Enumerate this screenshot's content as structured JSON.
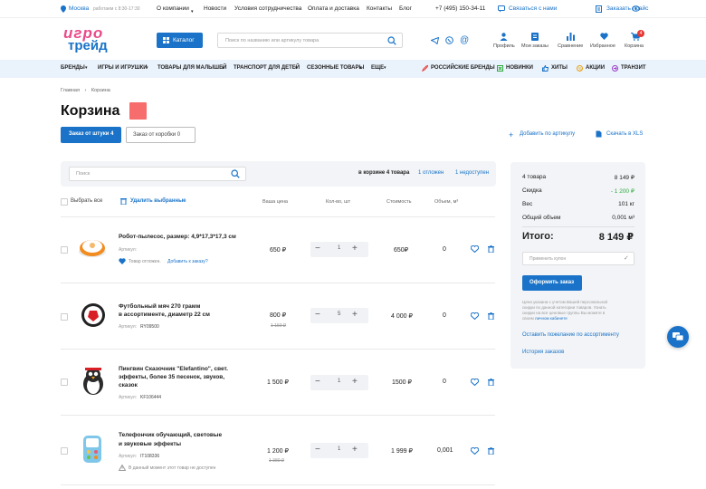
{
  "topbar": {
    "city": "Москва",
    "hours": "работаем с 8:30-17:30",
    "links": [
      "О компании",
      "Новости",
      "Условия сотрудничества",
      "Оплата и доставка",
      "Контакты",
      "Блог"
    ],
    "phone": "+7 (495) 150-34-11",
    "contact_link": "Связаться с нами",
    "price_link": "Заказать прайс"
  },
  "header": {
    "logo_top": "игро",
    "logo_bottom": "трейд",
    "catalog_label": "Каталог",
    "search_placeholder": "Поиск по названию или артикулу товара",
    "icons": [
      {
        "label": "Профиль",
        "icon": "profile-icon"
      },
      {
        "label": "Мои заказы",
        "icon": "orders-icon"
      },
      {
        "label": "Сравнение",
        "icon": "compare-icon"
      },
      {
        "label": "Избранное",
        "icon": "heart-icon"
      },
      {
        "label": "Корзина",
        "icon": "cart-icon",
        "badge": "4"
      }
    ]
  },
  "nav": {
    "items": [
      "Бренды",
      "Игры и игрушки",
      "Товары для малышей",
      "Транспорт для детей",
      "Сезонные товары",
      "Еще"
    ],
    "promo": [
      "Российские бренды",
      "Новинки",
      "Хиты",
      "Акции",
      "Транзит"
    ]
  },
  "breadcrumb": [
    "Главная",
    "Корзина"
  ],
  "page_title": "Корзина",
  "tabs": [
    "Заказ от штуки 4",
    "Заказ  от коробки 0"
  ],
  "actions": {
    "add_by_sku": "Добавить по артикулу",
    "download": "Скачать в XLS"
  },
  "filter": {
    "search_placeholder": "Поиск",
    "in_cart": "в корзине 4 товара",
    "deferred": "1 отложен",
    "unavailable": "1 недоступен"
  },
  "table": {
    "select_all": "Выбрать все",
    "delete_selected": "Удалить выбранные",
    "col_price": "Ваша цена",
    "col_qty": "Кол-во, шт",
    "col_cost": "Стоимость",
    "col_volume": "Объем, м³"
  },
  "rows": [
    {
      "name": "Робот-пылесос, размер: 4,9*17,3*17,3 см",
      "name2": "",
      "name3": "",
      "sku_label": "Артикул:",
      "sku": "",
      "note": "Товар отложен.",
      "note_link": "Добавить к заказу?",
      "price": "650 ₽",
      "old_price": "",
      "qty": "1",
      "cost": "650₽",
      "volume": "0"
    },
    {
      "name": "Футбольный мяч 270 грамм",
      "name2": "в ассортименте, диаметр 22 см",
      "name3": "",
      "sku_label": "Артикул:",
      "sku": "RY09500",
      "note": "",
      "note_link": "",
      "price": "800 ₽",
      "old_price": "1 150 ₽",
      "qty": "5",
      "cost": "4 000 ₽",
      "volume": "0"
    },
    {
      "name": "Пингвин Сказочник \"Elefantino\", свет.",
      "name2": "эффекты, более 35 песенок, звуков,",
      "name3": "сказок",
      "sku_label": "Артикул:",
      "sku": "KF106444",
      "note": "",
      "note_link": "",
      "price": "1 500 ₽",
      "old_price": "",
      "qty": "1",
      "cost": "1500 ₽",
      "volume": "0"
    },
    {
      "name": "Телефончик обучающий, световые",
      "name2": "и звуковые эффекты",
      "name3": "",
      "sku_label": "Артикул:",
      "sku": "IT108336",
      "note": "В данный момент этот товар не доступен",
      "note_link": "",
      "price": "1 200 ₽",
      "old_price": "1 380 ₽",
      "qty": "1",
      "cost": "1 999 ₽",
      "volume": "0,001"
    }
  ],
  "summary": {
    "rows": [
      {
        "label": "4 товара",
        "value": "8 149 ₽"
      },
      {
        "label": "Скидка",
        "value": "- 1 200 ₽"
      },
      {
        "label": "Вес",
        "value": "101 кг"
      },
      {
        "label": "Общий объем",
        "value": "0,001 м³"
      }
    ],
    "total_label": "Итого:",
    "total_value": "8 149 ₽",
    "coupon_placeholder": "Применить купон",
    "checkout": "Оформить заказ",
    "info": [
      "Цена указана с учетом Вашей персональной",
      "скидки по данной категории товаров. Узнать",
      "скидки на все ценовые группы Вы можете в"
    ],
    "info_prefix": "своем",
    "info_link": "личном кабинете",
    "wish_link": "Оставить пожелание по ассортименту",
    "history_link": "История заказов"
  },
  "colors": {
    "accent": "#1a73c8",
    "discount": "#2eaa3c",
    "badge": "#e53935"
  }
}
